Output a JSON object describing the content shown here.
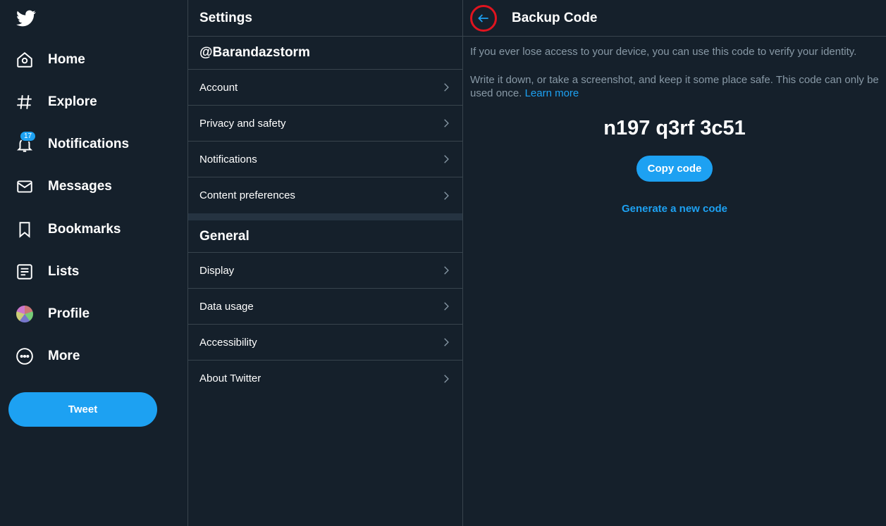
{
  "nav": {
    "items": [
      {
        "label": "Home",
        "icon": "home-icon"
      },
      {
        "label": "Explore",
        "icon": "hashtag-icon"
      },
      {
        "label": "Notifications",
        "icon": "bell-icon",
        "badge": "17"
      },
      {
        "label": "Messages",
        "icon": "envelope-icon"
      },
      {
        "label": "Bookmarks",
        "icon": "bookmark-icon"
      },
      {
        "label": "Lists",
        "icon": "list-icon"
      },
      {
        "label": "Profile",
        "icon": "avatar"
      },
      {
        "label": "More",
        "icon": "more-icon"
      }
    ],
    "tweet_label": "Tweet"
  },
  "settings": {
    "title": "Settings",
    "account_handle": "@Barandazstorm",
    "account_rows": [
      "Account",
      "Privacy and safety",
      "Notifications",
      "Content preferences"
    ],
    "general_title": "General",
    "general_rows": [
      "Display",
      "Data usage",
      "Accessibility",
      "About Twitter"
    ]
  },
  "detail": {
    "title": "Backup Code",
    "p1": "If you ever lose access to your device, you can use this code to verify your identity.",
    "p2": "Write it down, or take a screenshot, and keep it some place safe. This code can only be used once.",
    "learn_more": "Learn more",
    "code": "n197 q3rf 3c51",
    "copy_label": "Copy code",
    "generate_label": "Generate a new code"
  },
  "colors": {
    "background": "#15202b",
    "accent": "#1da1f2",
    "border": "#38444d",
    "muted": "#8899a6",
    "highlight_ring": "#e0141f"
  }
}
